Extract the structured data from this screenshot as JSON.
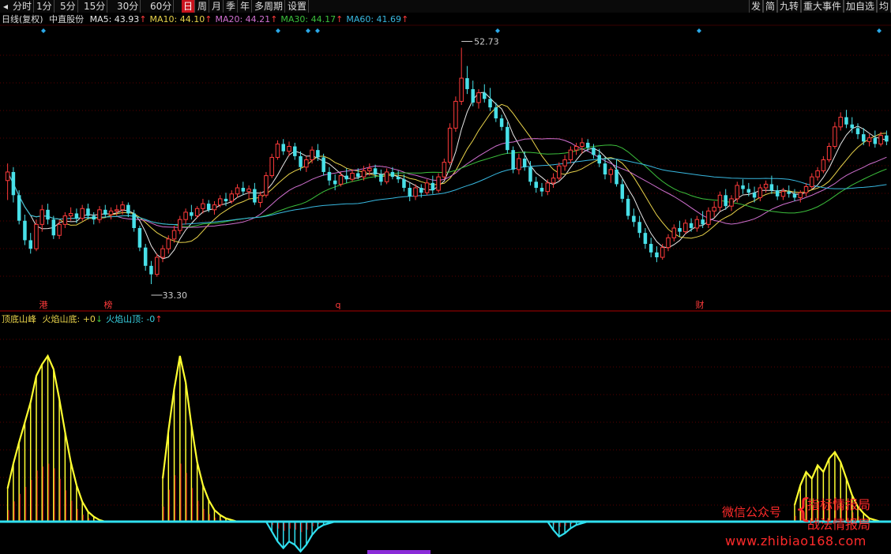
{
  "toolbar": {
    "left": [
      "分时",
      "1分",
      "5分",
      "15分",
      "30分",
      "60分",
      "日",
      "周",
      "月",
      "季",
      "年",
      "多周期",
      "设置"
    ],
    "active": "日",
    "right": [
      "发",
      "简",
      "九转",
      "重大事件",
      "加自选",
      "均"
    ]
  },
  "legend": {
    "period": "日线(复权)",
    "stock": "中直股份",
    "ma": [
      {
        "label": "MA5: ",
        "value": "43.93",
        "arrow": "↑",
        "color": "#e8e8e8"
      },
      {
        "label": "MA10: ",
        "value": "44.10",
        "arrow": "↑",
        "color": "#e8d24a"
      },
      {
        "label": "MA20: ",
        "value": "44.21",
        "arrow": "↑",
        "color": "#d070d0"
      },
      {
        "label": "MA30: ",
        "value": "44.17",
        "arrow": "↑",
        "color": "#3cc03c"
      },
      {
        "label": "MA60: ",
        "value": "41.69",
        "arrow": "↑",
        "color": "#38b8e0"
      }
    ]
  },
  "price_labels": {
    "high": "52.73",
    "low": "33.30"
  },
  "event_marks": [
    {
      "text": "港",
      "color": "#ff3b3b"
    },
    {
      "text": "榜",
      "color": "#ff3b3b"
    },
    {
      "text": "q",
      "color": "#ff3b3b"
    },
    {
      "text": "财",
      "color": "#ff3b3b"
    }
  ],
  "indicator": {
    "name": "顶底山峰",
    "items": [
      {
        "label": "火焰山底: ",
        "value": "+0",
        "arrow": "↓",
        "color": "#e8d24a"
      },
      {
        "label": "火焰山顶: ",
        "value": "-0",
        "arrow": "↑",
        "color": "#38d0e0"
      }
    ]
  },
  "watermark": {
    "line1": "微信公众号",
    "line2": "指标情报局",
    "line3": "战法情报局",
    "url": "www.zhibiao168.com"
  },
  "colors": {
    "up": "#ff3b3b",
    "down": "#48e0e8",
    "grid": "#5a0000",
    "axis": "#aa0000",
    "flame_bottom": "#ffff30",
    "flame_top": "#30e0f0",
    "flame_inner": "#c81818"
  },
  "chart_data": {
    "type": "candlestick",
    "y_range": [
      33.3,
      52.73
    ],
    "candles": [
      [
        41.8,
        43.2,
        40.2,
        42.5
      ],
      [
        42.5,
        42.9,
        40.0,
        40.6
      ],
      [
        40.6,
        41.0,
        38.2,
        38.5
      ],
      [
        38.5,
        39.0,
        36.5,
        36.9
      ],
      [
        36.9,
        37.5,
        35.8,
        36.2
      ],
      [
        36.2,
        38.6,
        36.0,
        38.2
      ],
      [
        38.2,
        39.8,
        37.6,
        39.4
      ],
      [
        39.4,
        39.9,
        38.2,
        38.6
      ],
      [
        38.6,
        38.9,
        37.0,
        37.3
      ],
      [
        37.3,
        38.6,
        37.0,
        38.2
      ],
      [
        38.2,
        39.2,
        37.9,
        38.9
      ],
      [
        38.9,
        39.6,
        38.5,
        39.1
      ],
      [
        39.1,
        39.5,
        38.3,
        38.7
      ],
      [
        38.7,
        39.8,
        38.5,
        39.5
      ],
      [
        39.5,
        39.9,
        38.6,
        38.9
      ],
      [
        38.9,
        39.2,
        38.2,
        38.6
      ],
      [
        38.6,
        39.7,
        38.3,
        39.4
      ],
      [
        39.4,
        39.8,
        38.8,
        39.0
      ],
      [
        39.0,
        39.6,
        38.6,
        39.3
      ],
      [
        39.3,
        39.8,
        38.9,
        39.4
      ],
      [
        39.4,
        40.1,
        39.0,
        39.8
      ],
      [
        39.8,
        40.0,
        38.8,
        39.1
      ],
      [
        39.1,
        39.4,
        37.6,
        37.9
      ],
      [
        37.9,
        38.1,
        36.0,
        36.3
      ],
      [
        36.3,
        36.6,
        34.4,
        34.8
      ],
      [
        34.8,
        35.2,
        33.3,
        34.1
      ],
      [
        34.1,
        35.8,
        33.9,
        35.5
      ],
      [
        35.5,
        36.5,
        35.1,
        36.2
      ],
      [
        36.2,
        37.3,
        35.8,
        37.0
      ],
      [
        37.0,
        38.1,
        36.7,
        37.7
      ],
      [
        37.7,
        38.9,
        37.4,
        38.6
      ],
      [
        38.6,
        39.5,
        38.2,
        39.2
      ],
      [
        39.2,
        39.8,
        38.6,
        38.9
      ],
      [
        38.9,
        39.7,
        38.7,
        39.5
      ],
      [
        39.5,
        40.3,
        39.1,
        39.9
      ],
      [
        39.9,
        40.2,
        39.2,
        39.4
      ],
      [
        39.4,
        40.1,
        39.0,
        39.8
      ],
      [
        39.8,
        40.6,
        39.6,
        40.3
      ],
      [
        40.3,
        40.8,
        39.7,
        40.1
      ],
      [
        40.1,
        41.0,
        39.9,
        40.7
      ],
      [
        40.7,
        41.5,
        40.4,
        41.2
      ],
      [
        41.2,
        41.7,
        40.6,
        40.9
      ],
      [
        40.9,
        41.4,
        40.3,
        41.1
      ],
      [
        41.1,
        41.6,
        39.8,
        40.0
      ],
      [
        40.0,
        40.9,
        39.6,
        40.6
      ],
      [
        40.6,
        42.5,
        40.4,
        42.2
      ],
      [
        42.2,
        44.0,
        42.0,
        43.7
      ],
      [
        43.7,
        45.1,
        43.5,
        44.8
      ],
      [
        44.8,
        45.2,
        43.9,
        44.2
      ],
      [
        44.2,
        45.0,
        43.8,
        44.6
      ],
      [
        44.6,
        44.9,
        43.5,
        43.8
      ],
      [
        43.8,
        44.2,
        42.6,
        42.9
      ],
      [
        42.9,
        43.8,
        42.5,
        43.5
      ],
      [
        43.5,
        44.6,
        43.2,
        44.3
      ],
      [
        44.3,
        44.8,
        43.4,
        43.7
      ],
      [
        43.7,
        44.0,
        42.2,
        42.5
      ],
      [
        42.5,
        42.9,
        41.4,
        41.8
      ],
      [
        41.8,
        42.3,
        41.0,
        41.5
      ],
      [
        41.5,
        42.5,
        41.3,
        42.2
      ],
      [
        42.2,
        42.8,
        41.6,
        41.9
      ],
      [
        41.9,
        42.7,
        41.7,
        42.4
      ],
      [
        42.4,
        42.8,
        41.9,
        42.1
      ],
      [
        42.1,
        43.0,
        41.8,
        42.6
      ],
      [
        42.6,
        43.2,
        42.2,
        42.8
      ],
      [
        42.8,
        43.1,
        42.0,
        42.3
      ],
      [
        42.3,
        42.7,
        41.4,
        41.7
      ],
      [
        41.7,
        42.8,
        41.5,
        42.5
      ],
      [
        42.5,
        42.9,
        41.9,
        42.1
      ],
      [
        42.1,
        42.6,
        41.6,
        41.9
      ],
      [
        41.9,
        42.3,
        40.9,
        41.2
      ],
      [
        41.2,
        41.6,
        40.1,
        40.5
      ],
      [
        40.5,
        41.5,
        40.2,
        41.2
      ],
      [
        41.2,
        41.5,
        40.4,
        40.8
      ],
      [
        40.8,
        41.9,
        40.6,
        41.6
      ],
      [
        41.6,
        42.2,
        40.7,
        41.0
      ],
      [
        41.0,
        42.4,
        40.8,
        42.1
      ],
      [
        42.1,
        43.6,
        41.9,
        43.3
      ],
      [
        43.3,
        46.5,
        43.1,
        46.1
      ],
      [
        46.1,
        48.7,
        45.8,
        48.3
      ],
      [
        48.3,
        52.7,
        48.0,
        50.2
      ],
      [
        50.2,
        51.2,
        48.9,
        49.3
      ],
      [
        49.3,
        50.0,
        47.9,
        48.2
      ],
      [
        48.2,
        49.3,
        47.7,
        49.0
      ],
      [
        49.0,
        49.7,
        48.2,
        48.5
      ],
      [
        48.5,
        49.4,
        47.5,
        47.8
      ],
      [
        47.8,
        48.2,
        46.6,
        46.9
      ],
      [
        46.9,
        47.2,
        45.9,
        46.2
      ],
      [
        46.2,
        46.6,
        44.0,
        44.3
      ],
      [
        44.3,
        44.6,
        42.4,
        42.7
      ],
      [
        42.7,
        44.0,
        42.3,
        43.6
      ],
      [
        43.6,
        44.2,
        42.6,
        42.9
      ],
      [
        42.9,
        43.4,
        41.4,
        41.7
      ],
      [
        41.7,
        42.1,
        40.8,
        41.2
      ],
      [
        41.2,
        41.6,
        40.5,
        40.9
      ],
      [
        40.9,
        41.9,
        40.6,
        41.6
      ],
      [
        41.6,
        42.4,
        41.2,
        42.0
      ],
      [
        42.0,
        43.3,
        41.8,
        43.0
      ],
      [
        43.0,
        43.9,
        42.6,
        43.5
      ],
      [
        43.5,
        44.6,
        43.2,
        44.3
      ],
      [
        44.3,
        44.9,
        43.9,
        44.6
      ],
      [
        44.6,
        45.3,
        44.0,
        44.9
      ],
      [
        44.9,
        45.2,
        44.2,
        44.5
      ],
      [
        44.5,
        44.8,
        43.6,
        43.9
      ],
      [
        43.9,
        44.4,
        42.9,
        43.2
      ],
      [
        43.2,
        43.7,
        41.9,
        42.3
      ],
      [
        42.3,
        42.9,
        41.6,
        42.7
      ],
      [
        42.7,
        43.5,
        41.3,
        41.5
      ],
      [
        41.5,
        41.9,
        40.0,
        40.3
      ],
      [
        40.3,
        40.6,
        38.6,
        38.9
      ],
      [
        38.9,
        39.5,
        38.0,
        38.4
      ],
      [
        38.4,
        38.9,
        37.1,
        37.5
      ],
      [
        37.5,
        37.9,
        36.2,
        36.6
      ],
      [
        36.6,
        37.1,
        35.5,
        35.9
      ],
      [
        35.9,
        36.4,
        35.1,
        35.5
      ],
      [
        35.5,
        36.6,
        35.3,
        36.3
      ],
      [
        36.3,
        37.4,
        36.0,
        37.1
      ],
      [
        37.1,
        38.2,
        36.8,
        37.9
      ],
      [
        37.9,
        38.5,
        37.2,
        37.6
      ],
      [
        37.6,
        38.6,
        37.4,
        38.3
      ],
      [
        38.3,
        38.7,
        37.6,
        37.9
      ],
      [
        37.9,
        38.9,
        37.6,
        38.6
      ],
      [
        38.6,
        39.3,
        37.9,
        38.2
      ],
      [
        38.2,
        39.6,
        37.9,
        39.3
      ],
      [
        39.3,
        40.1,
        38.8,
        39.6
      ],
      [
        39.6,
        40.9,
        39.3,
        40.6
      ],
      [
        40.6,
        41.1,
        39.4,
        39.7
      ],
      [
        39.7,
        40.6,
        39.3,
        40.3
      ],
      [
        40.3,
        41.7,
        40.0,
        41.4
      ],
      [
        41.4,
        41.9,
        40.7,
        41.1
      ],
      [
        41.1,
        41.6,
        40.5,
        40.8
      ],
      [
        40.8,
        41.3,
        40.0,
        40.4
      ],
      [
        40.4,
        41.5,
        40.1,
        41.2
      ],
      [
        41.2,
        41.8,
        40.8,
        41.5
      ],
      [
        41.5,
        42.2,
        40.7,
        41.0
      ],
      [
        41.0,
        41.4,
        40.2,
        40.5
      ],
      [
        40.5,
        41.2,
        40.2,
        40.9
      ],
      [
        40.9,
        41.4,
        40.4,
        40.7
      ],
      [
        40.7,
        41.1,
        40.1,
        40.4
      ],
      [
        40.4,
        41.0,
        40.0,
        40.8
      ],
      [
        40.8,
        41.6,
        40.5,
        41.3
      ],
      [
        41.3,
        42.4,
        41.1,
        42.1
      ],
      [
        42.1,
        42.9,
        41.8,
        42.6
      ],
      [
        42.6,
        43.8,
        42.4,
        43.5
      ],
      [
        43.5,
        44.9,
        43.3,
        44.6
      ],
      [
        44.6,
        46.6,
        44.4,
        46.2
      ],
      [
        46.2,
        47.4,
        45.9,
        47.0
      ],
      [
        47.0,
        47.6,
        46.1,
        46.4
      ],
      [
        46.4,
        47.0,
        45.7,
        46.1
      ],
      [
        46.1,
        46.5,
        45.2,
        45.6
      ],
      [
        45.6,
        46.1,
        44.7,
        45.0
      ],
      [
        45.0,
        45.6,
        44.6,
        45.3
      ],
      [
        45.3,
        45.9,
        44.5,
        44.8
      ],
      [
        44.8,
        45.8,
        44.6,
        45.5
      ],
      [
        45.5,
        45.9,
        44.7,
        45.0
      ]
    ],
    "flame_bottom": [
      20,
      35,
      48,
      60,
      72,
      88,
      95,
      100,
      92,
      74,
      54,
      36,
      22,
      12,
      6,
      3,
      1,
      0,
      0,
      0,
      0,
      0,
      0,
      0,
      0,
      0,
      0,
      26,
      55,
      80,
      100,
      84,
      58,
      36,
      22,
      13,
      7,
      4,
      2,
      1,
      0,
      0,
      0,
      0,
      0,
      0,
      0,
      0,
      0,
      0,
      0,
      0,
      0,
      0,
      0,
      0,
      0,
      0,
      0,
      0,
      0,
      0,
      0,
      0,
      0,
      0,
      0,
      0,
      0,
      0,
      0,
      0,
      0,
      0,
      0,
      0,
      0,
      0,
      0,
      0,
      0,
      0,
      0,
      0,
      0,
      0,
      0,
      0,
      0,
      0,
      0,
      0,
      0,
      0,
      0,
      0,
      0,
      0,
      0,
      0,
      0,
      0,
      0,
      0,
      0,
      0,
      0,
      0,
      0,
      0,
      0,
      0,
      0,
      0,
      0,
      0,
      0,
      0,
      0,
      0,
      0,
      0,
      0,
      0,
      0,
      0,
      0,
      0,
      0,
      0,
      0,
      0,
      0,
      0,
      0,
      0,
      0,
      0,
      0,
      0,
      0,
      0,
      0,
      0,
      0,
      0,
      0,
      0,
      0,
      0,
      0,
      0,
      0,
      0,
      0,
      0,
      0,
      0,
      0,
      0,
      0,
      0,
      0,
      0,
      0,
      0,
      0,
      0
    ],
    "flame_top": []
  }
}
